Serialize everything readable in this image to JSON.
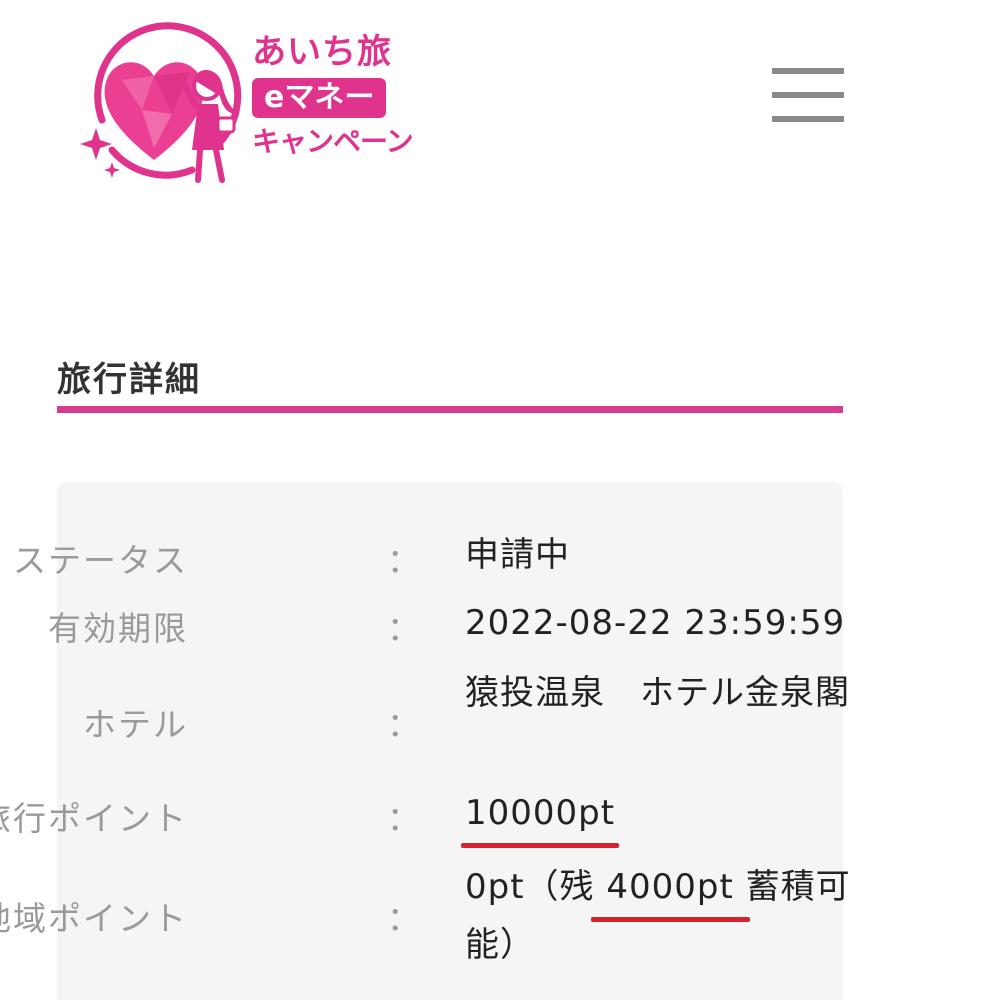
{
  "header": {
    "logo": {
      "line1": "あいち旅",
      "badge": "eマネー",
      "line3": "キャンペーン"
    },
    "menu_icon": "hamburger-menu-icon"
  },
  "section": {
    "title": "旅行詳細"
  },
  "details": {
    "status": {
      "label": "ステータス",
      "value": "申請中"
    },
    "expiry": {
      "label": "有効期限",
      "value": "2022-08-22 23:59:59"
    },
    "hotel": {
      "label": "ホテル",
      "value": "猿投温泉　ホテル金泉閣"
    },
    "travel_points": {
      "label": "旅行ポイント",
      "value": "10000pt"
    },
    "regional_points": {
      "label": "地域ポイント",
      "value_prefix": "0pt（残",
      "value_highlight": " 4000pt ",
      "value_suffix": "蓄積可能）"
    },
    "colon": "："
  },
  "colors": {
    "brand_pink": "#e0338e",
    "rule_pink": "#d63b8e",
    "highlight_red": "#d4232f"
  }
}
